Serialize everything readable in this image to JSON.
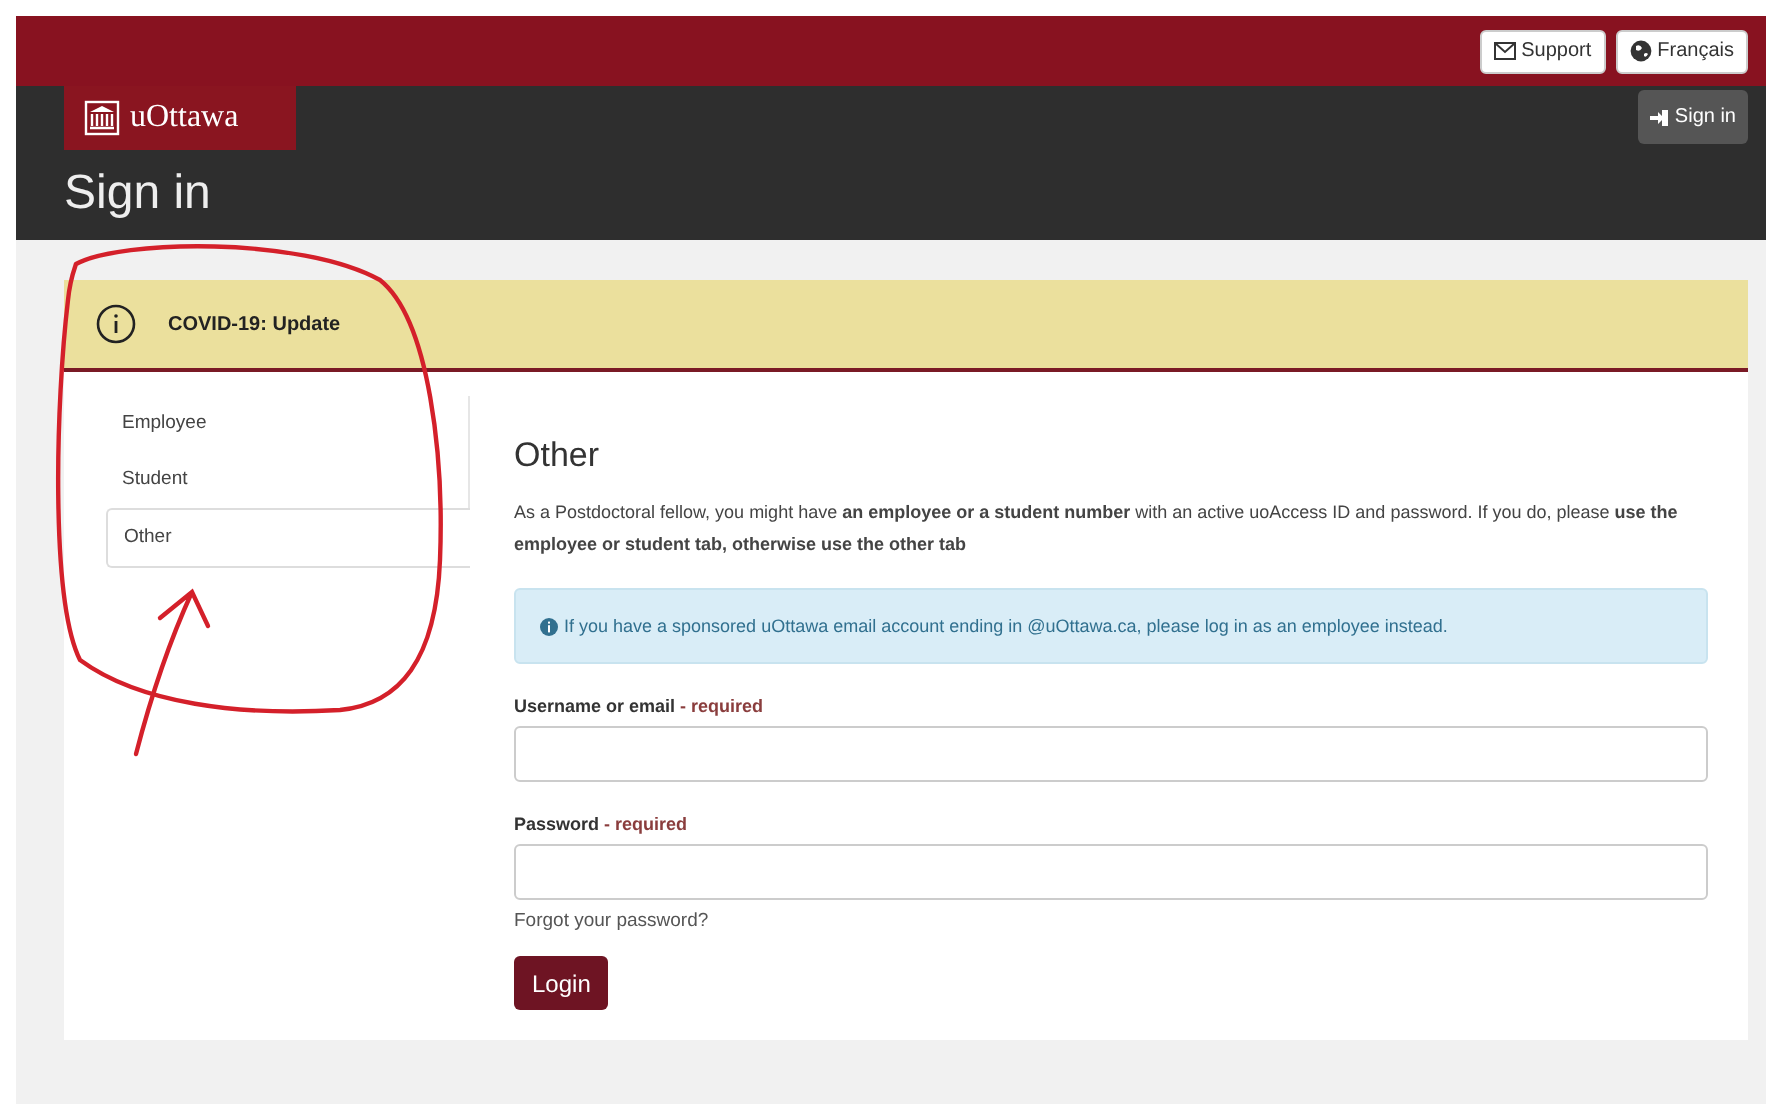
{
  "top_bar": {
    "buttons": [
      {
        "label": "Support"
      },
      {
        "label": "Français"
      }
    ]
  },
  "header": {
    "logo_text": "uOttawa",
    "sign_in_button": "Sign in",
    "title": "Sign in"
  },
  "alert": {
    "text": "COVID-19: Update"
  },
  "tabs": [
    {
      "label": "Employee",
      "selected": false
    },
    {
      "label": "Student",
      "selected": false
    },
    {
      "label": "Other",
      "selected": true
    }
  ],
  "panel": {
    "heading": "Other",
    "intro": "As a Postdoctoral fellow, you might have **an employee or a student number** with an active uoAccess ID and password. If you do, please **use the employee or student tab, otherwise use the other tab**",
    "notice": "If you have a sponsored uOttawa email account ending in @uOttawa.ca, please log in as an employee instead.",
    "fields": [
      {
        "label": "Username or email",
        "required": " - required"
      },
      {
        "label": "Password",
        "required": " - required"
      }
    ],
    "forgot_link": "Forgot your password?",
    "login_button": "Login"
  },
  "annotation": {
    "kind": "circle-and-arrow"
  }
}
